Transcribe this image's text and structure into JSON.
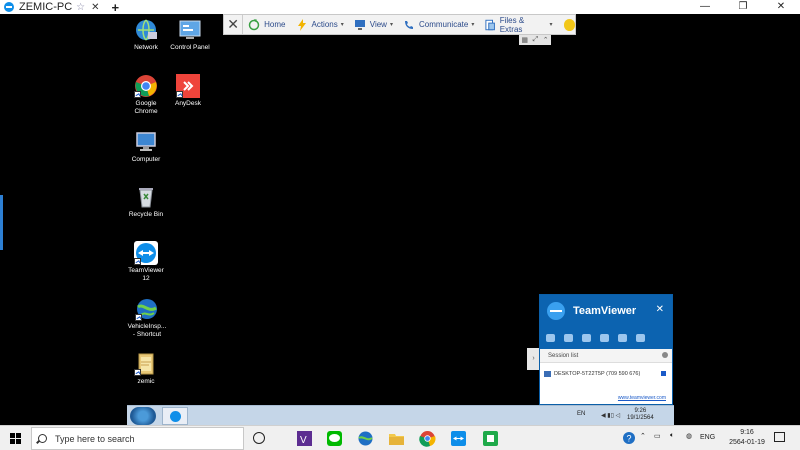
{
  "window": {
    "tab_title": "ZEMIC-PC",
    "star_glyph": "☆",
    "close_glyph": "✕",
    "new_tab_glyph": "+",
    "minimize_glyph": "—",
    "restore_glyph": "❐",
    "close_window_glyph": "✕"
  },
  "desktop_icons": [
    {
      "label": "Network",
      "icon": "network-icon"
    },
    {
      "label": "Control Panel",
      "icon": "control-panel-icon"
    },
    {
      "label": "Google Chrome",
      "icon": "chrome-icon"
    },
    {
      "label": "AnyDesk",
      "icon": "anydesk-icon"
    },
    {
      "label": "Computer",
      "icon": "computer-icon"
    },
    {
      "label": "Recycle Bin",
      "icon": "recycle-bin-icon"
    },
    {
      "label": "TeamViewer 12",
      "icon": "teamviewer-icon"
    },
    {
      "label": "VehicleInsp... - Shortcut",
      "icon": "vehicle-inspection-icon"
    },
    {
      "label": "zemic",
      "icon": "folder-icon"
    }
  ],
  "toolbar": {
    "close_glyph": "✕",
    "home": "Home",
    "actions": "Actions",
    "view": "View",
    "communicate": "Communicate",
    "files": "Files & Extras",
    "caret": "▾"
  },
  "tv_panel": {
    "brand": "TeamViewer",
    "close_glyph": "✕",
    "side_tab_glyph": "›",
    "session_list": "Session list",
    "session_entry": "DESKTOP-5T22T5P (709 590 676)",
    "website": "www.teamviewer.com"
  },
  "remote_taskbar": {
    "lang": "EN",
    "time": "9:26",
    "date": "19/1/2564"
  },
  "taskbar": {
    "search_placeholder": "Type here to search",
    "lang": "ENG",
    "time": "9:16",
    "date": "2564-01-19"
  },
  "colors": {
    "accent": "#0c63b0",
    "teamviewer_blue": "#0e8ee9",
    "chrome_red": "#db4437",
    "anydesk_red": "#ef443b"
  }
}
